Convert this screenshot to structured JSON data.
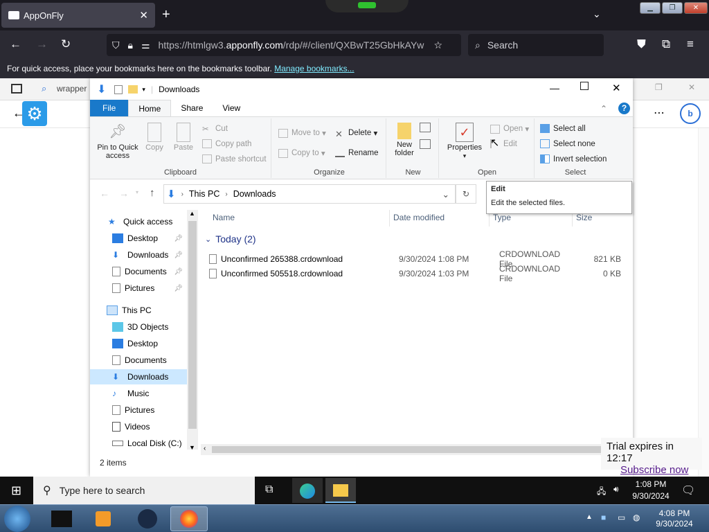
{
  "browser": {
    "tab_title": "AppOnFly",
    "url_prefix": "https://htmlgw3.",
    "url_domain": "apponfly.com",
    "url_rest": "/rdp/#/client/QXBwT25GbHkAYw",
    "search_placeholder": "Search",
    "bookmarks_text": "For quick access, place your bookmarks here on the bookmarks toolbar.",
    "bookmarks_link": "Manage bookmarks...",
    "inner_tab_text": "wrapper"
  },
  "explorer": {
    "title": "Downloads",
    "ribbon_tabs": [
      "File",
      "Home",
      "Share",
      "View"
    ],
    "clipboard": {
      "pin": "Pin to Quick access",
      "copy": "Copy",
      "paste": "Paste",
      "cut": "Cut",
      "copy_path": "Copy path",
      "paste_shortcut": "Paste shortcut",
      "label": "Clipboard"
    },
    "organize": {
      "move_to": "Move to",
      "copy_to": "Copy to",
      "delete": "Delete",
      "rename": "Rename",
      "label": "Organize"
    },
    "new": {
      "new_folder": "New folder",
      "label": "New"
    },
    "open": {
      "properties": "Properties",
      "open": "Open",
      "edit": "Edit",
      "label": "Open"
    },
    "select": {
      "select_all": "Select all",
      "select_none": "Select none",
      "invert": "Invert selection",
      "label": "Select"
    },
    "breadcrumb": [
      "This PC",
      "Downloads"
    ],
    "columns": {
      "name": "Name",
      "date": "Date modified",
      "type": "Type",
      "size": "Size"
    },
    "group": "Today (2)",
    "files": [
      {
        "name": "Unconfirmed 265388.crdownload",
        "date": "9/30/2024 1:08 PM",
        "type": "CRDOWNLOAD File",
        "size": "821 KB"
      },
      {
        "name": "Unconfirmed 505518.crdownload",
        "date": "9/30/2024 1:03 PM",
        "type": "CRDOWNLOAD File",
        "size": "0 KB"
      }
    ],
    "nav": {
      "quick_access": "Quick access",
      "qa_items": [
        "Desktop",
        "Downloads",
        "Documents",
        "Pictures"
      ],
      "this_pc": "This PC",
      "pc_items": [
        "3D Objects",
        "Desktop",
        "Documents",
        "Downloads",
        "Music",
        "Pictures",
        "Videos",
        "Local Disk (C:)"
      ]
    },
    "status": "2 items",
    "tooltip": {
      "title": "Edit",
      "body": "Edit the selected files."
    }
  },
  "trial": {
    "text": "Trial expires in 12:17",
    "link": "Subscribe now"
  },
  "taskbar10": {
    "search_placeholder": "Type here to search",
    "time": "1:08 PM",
    "date": "9/30/2024"
  },
  "taskbar7": {
    "time": "4:08 PM",
    "date": "9/30/2024"
  },
  "colors": {
    "file_tab": "#1979ca",
    "selection": "#cce8ff",
    "link": "#80ebff"
  }
}
